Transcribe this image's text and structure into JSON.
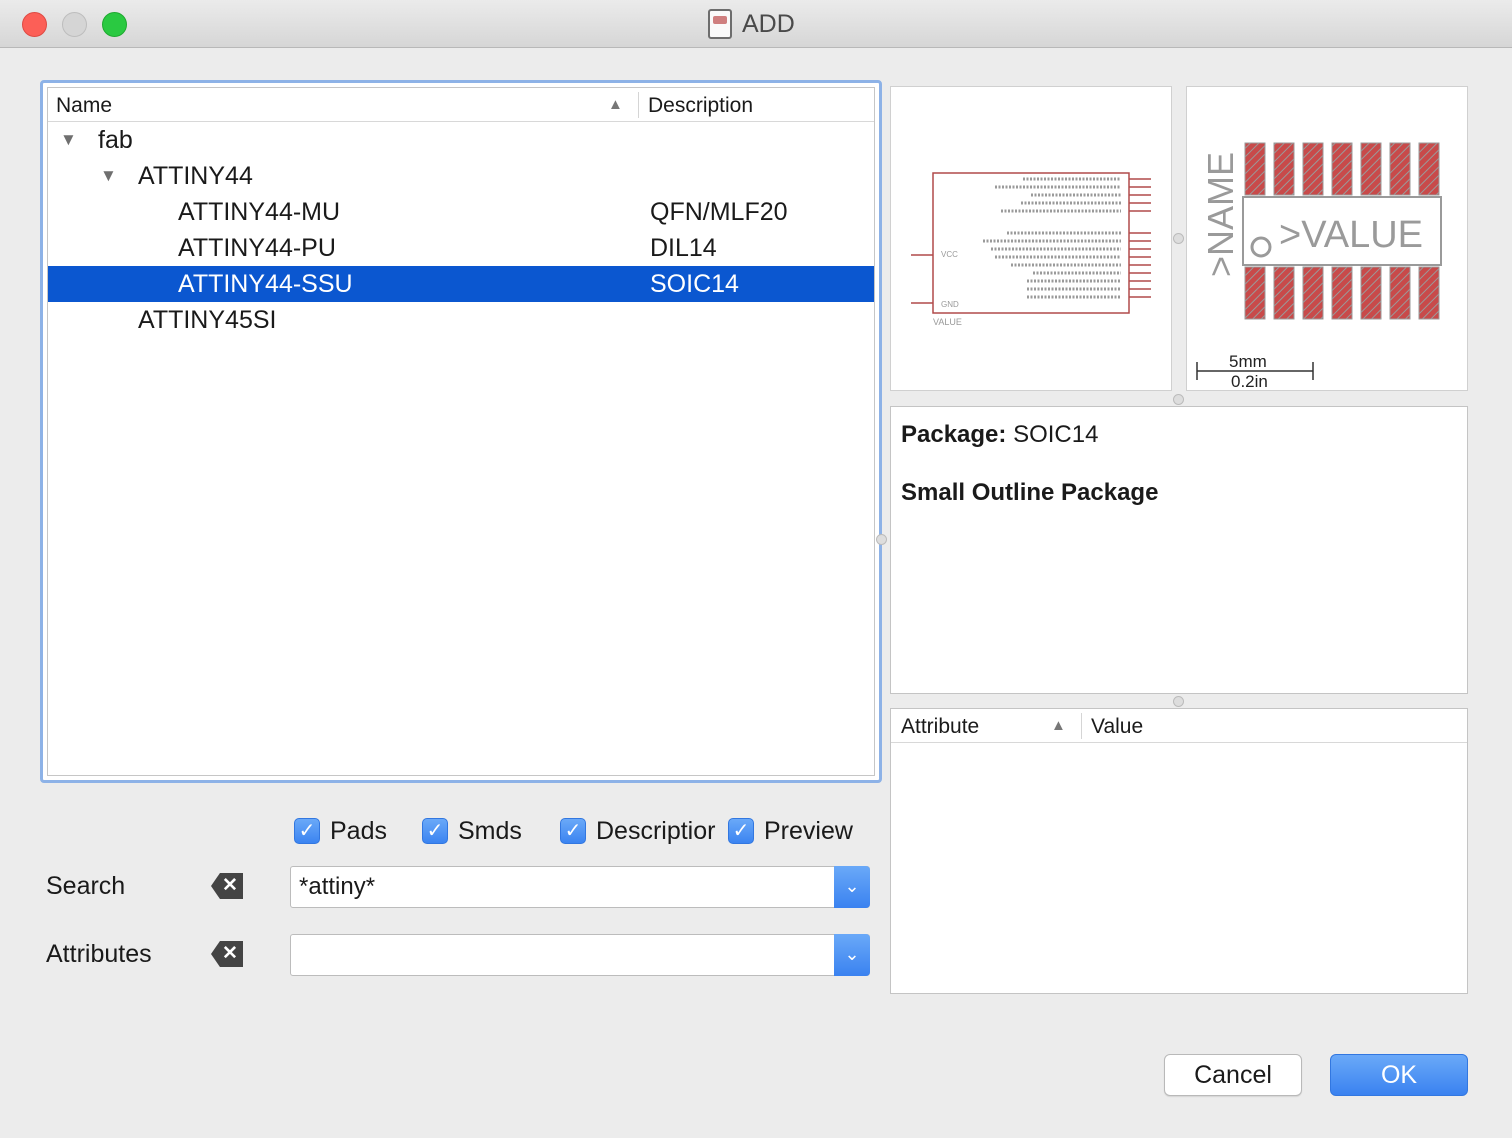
{
  "window": {
    "title": "ADD"
  },
  "tree": {
    "col_name": "Name",
    "col_desc": "Description",
    "rows": [
      {
        "label": "fab",
        "desc": ""
      },
      {
        "label": "ATTINY44",
        "desc": ""
      },
      {
        "label": "ATTINY44-MU",
        "desc": "QFN/MLF20"
      },
      {
        "label": "ATTINY44-PU",
        "desc": "DIL14"
      },
      {
        "label": "ATTINY44-SSU",
        "desc": "SOIC14"
      },
      {
        "label": "ATTINY45SI",
        "desc": ""
      }
    ]
  },
  "filters": {
    "pads": "Pads",
    "smds": "Smds",
    "description": "Descriptior",
    "preview": "Preview"
  },
  "search": {
    "label": "Search",
    "value": "*attiny*"
  },
  "attributes": {
    "label": "Attributes",
    "value": ""
  },
  "preview": {
    "symbol": {
      "value_text": "VALUE",
      "vcc_text": "VCC",
      "gnd_text": "GND"
    },
    "package": {
      "name_text": ">NAME",
      "value_text": ">VALUE",
      "scale_mm": "5mm",
      "scale_in": "0.2in"
    }
  },
  "info": {
    "package_label": "Package:",
    "package_name": "SOIC14",
    "package_desc": "Small Outline Package"
  },
  "attr_table": {
    "col_attr": "Attribute",
    "col_value": "Value"
  },
  "buttons": {
    "cancel": "Cancel",
    "ok": "OK"
  },
  "colors": {
    "accent": "#0b57d0",
    "pad": "#c84a4a",
    "symbol_line": "#b14a4a"
  }
}
